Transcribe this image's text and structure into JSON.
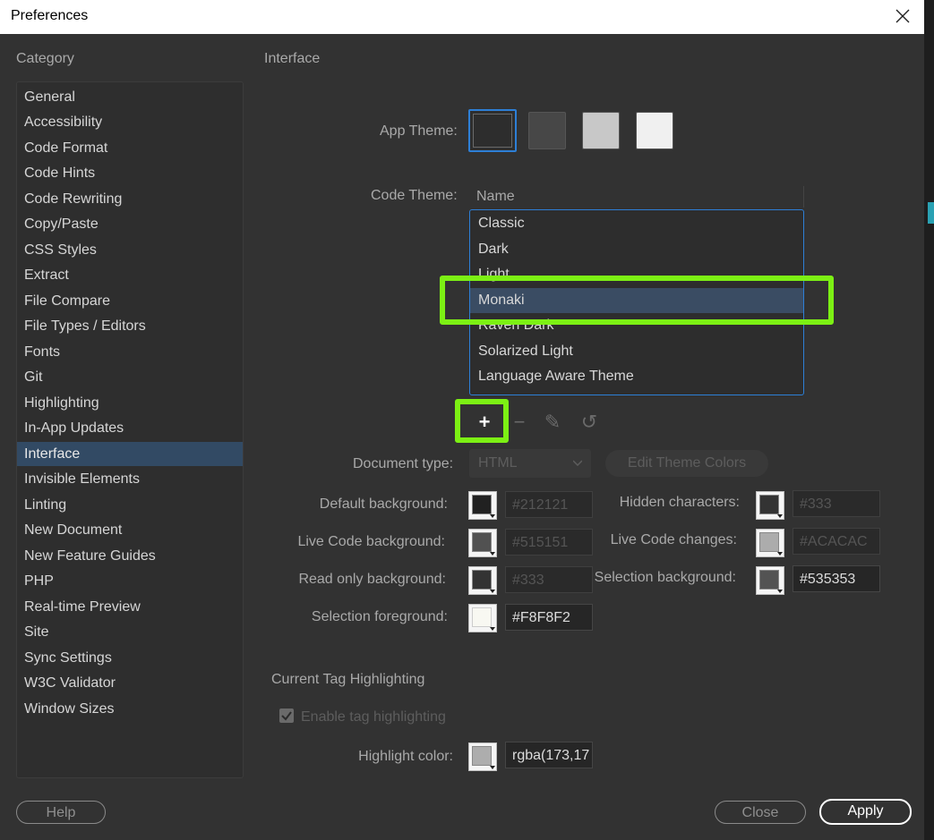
{
  "window": {
    "title": "Preferences"
  },
  "sidebar": {
    "heading": "Category",
    "items": [
      {
        "label": "General"
      },
      {
        "label": "Accessibility"
      },
      {
        "label": "Code Format"
      },
      {
        "label": "Code Hints"
      },
      {
        "label": "Code Rewriting"
      },
      {
        "label": "Copy/Paste"
      },
      {
        "label": "CSS Styles"
      },
      {
        "label": "Extract"
      },
      {
        "label": "File Compare"
      },
      {
        "label": "File Types / Editors"
      },
      {
        "label": "Fonts"
      },
      {
        "label": "Git"
      },
      {
        "label": "Highlighting"
      },
      {
        "label": "In-App Updates"
      },
      {
        "label": "Interface"
      },
      {
        "label": "Invisible Elements"
      },
      {
        "label": "Linting"
      },
      {
        "label": "New Document"
      },
      {
        "label": "New Feature Guides"
      },
      {
        "label": "PHP"
      },
      {
        "label": "Real-time Preview"
      },
      {
        "label": "Site"
      },
      {
        "label": "Sync Settings"
      },
      {
        "label": "W3C Validator"
      },
      {
        "label": "Window Sizes"
      }
    ],
    "selected": "Interface"
  },
  "main": {
    "heading": "Interface",
    "app_theme": {
      "label": "App Theme:",
      "swatches": [
        "#2d2d2d",
        "#474747",
        "#c8c8c8",
        "#f0f0f0"
      ],
      "selected_index": 0
    },
    "code_theme": {
      "label": "Code Theme:",
      "column_header": "Name",
      "themes": [
        "Classic",
        "Dark",
        "Light",
        "Monaki",
        "Raven Dark",
        "Solarized Light",
        "Language Aware Theme"
      ],
      "selected": "Monaki"
    },
    "toolbar": {
      "add": "+",
      "remove": "−",
      "edit": "✎",
      "reset": "↺"
    },
    "document_type": {
      "label": "Document type:",
      "value": "HTML"
    },
    "edit_theme_colors": "Edit Theme Colors",
    "colors": {
      "default_background": {
        "label": "Default background:",
        "value": "#212121",
        "swatch": "#212121"
      },
      "live_code_background": {
        "label": "Live Code background:",
        "value": "#515151",
        "swatch": "#515151"
      },
      "read_only_background": {
        "label": "Read only background:",
        "value": "#333",
        "swatch": "#333333"
      },
      "selection_foreground": {
        "label": "Selection foreground:",
        "value": "#F8F8F2",
        "swatch": "#F8F8F2"
      },
      "hidden_characters": {
        "label": "Hidden characters:",
        "value": "#333",
        "swatch": "#333333"
      },
      "live_code_changes": {
        "label": "Live Code changes:",
        "value": "#ACACAC",
        "swatch": "#ACACAC"
      },
      "selection_background": {
        "label": "Selection background:",
        "value": "#535353",
        "swatch": "#535353"
      }
    },
    "tag_highlighting": {
      "heading": "Current Tag Highlighting",
      "enable_label": "Enable tag highlighting",
      "enabled": true,
      "highlight_color_label": "Highlight color:",
      "highlight_color_value": "rgba(173,17",
      "highlight_swatch": "#adadad"
    }
  },
  "footer": {
    "help": "Help",
    "close": "Close",
    "apply": "Apply"
  },
  "colors": {
    "accent": "#2d7fd6",
    "annotation": "#7cf014",
    "selected_row": "#3a4c63"
  }
}
